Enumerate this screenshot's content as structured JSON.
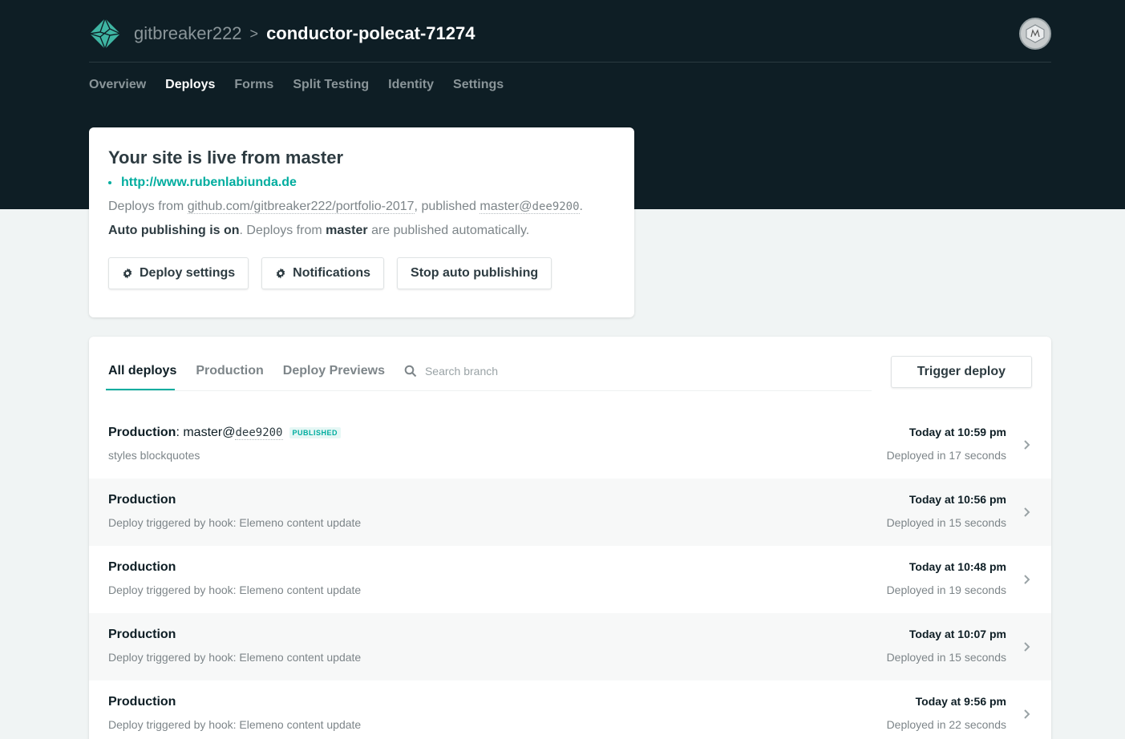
{
  "header": {
    "team": "gitbreaker222",
    "separator": ">",
    "site": "conductor-polecat-71274"
  },
  "nav": [
    "Overview",
    "Deploys",
    "Forms",
    "Split Testing",
    "Identity",
    "Settings"
  ],
  "live_card": {
    "title": "Your site is live from master",
    "url": "http://www.rubenlabiunda.de",
    "deploys_from_prefix": "Deploys from",
    "repo": "github.com/gitbreaker222/portfolio-2017",
    "published_text": ", published",
    "branch": "master@",
    "commit": "dee9200",
    "period": ".",
    "auto_label": "Auto publishing is on",
    "auto_text_1": ". Deploys from",
    "auto_branch": "master",
    "auto_text_2": "are published automatically.",
    "buttons": {
      "deploy_settings": "Deploy settings",
      "notifications": "Notifications",
      "stop_auto": "Stop auto publishing"
    }
  },
  "deploys": {
    "tabs": [
      "All deploys",
      "Production",
      "Deploy Previews"
    ],
    "search_placeholder": "Search branch",
    "trigger_label": "Trigger deploy",
    "rows": [
      {
        "context": "Production",
        "colon": ":",
        "branch": "master@",
        "commit": "dee9200",
        "badge": "PUBLISHED",
        "message": "styles blockquotes",
        "time": "Today at 10:59 pm",
        "duration": "Deployed in 17 seconds"
      },
      {
        "context": "Production",
        "message": "Deploy triggered by hook: Elemeno content update",
        "time": "Today at 10:56 pm",
        "duration": "Deployed in 15 seconds"
      },
      {
        "context": "Production",
        "message": "Deploy triggered by hook: Elemeno content update",
        "time": "Today at 10:48 pm",
        "duration": "Deployed in 19 seconds"
      },
      {
        "context": "Production",
        "message": "Deploy triggered by hook: Elemeno content update",
        "time": "Today at 10:07 pm",
        "duration": "Deployed in 15 seconds"
      },
      {
        "context": "Production",
        "message": "Deploy triggered by hook: Elemeno content update",
        "time": "Today at 9:56 pm",
        "duration": "Deployed in 22 seconds"
      }
    ]
  },
  "colors": {
    "header_bg": "#0e1e25",
    "accent": "#00ad9f",
    "page_bg": "#f0f4f4"
  }
}
